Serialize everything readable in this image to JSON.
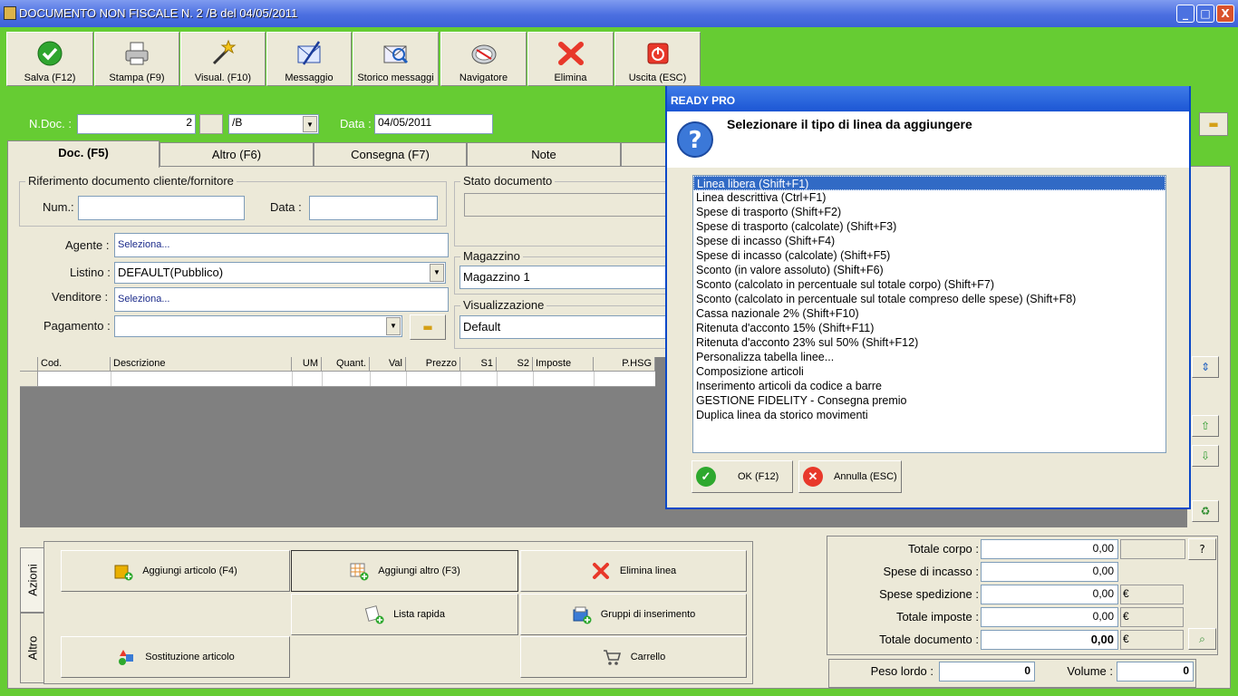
{
  "window": {
    "title": "DOCUMENTO NON FISCALE N.  2 /B del 04/05/2011",
    "min": "_",
    "max": "□",
    "close": "X"
  },
  "toolbar": [
    {
      "label": "Salva (F12)",
      "icon": "save-check-icon"
    },
    {
      "label": "Stampa (F9)",
      "icon": "printer-icon"
    },
    {
      "label": "Visual. (F10)",
      "icon": "magic-wand-icon"
    },
    {
      "label": "Messaggio",
      "icon": "message-icon"
    },
    {
      "label": "Storico messaggi",
      "icon": "message-history-icon"
    },
    {
      "label": "Navigatore",
      "icon": "navigator-icon"
    },
    {
      "label": "Elimina",
      "icon": "delete-x-icon"
    },
    {
      "label": "Uscita (ESC)",
      "icon": "exit-power-icon"
    }
  ],
  "header": {
    "ndoc_label": "N.Doc. :",
    "ndoc_value": "2",
    "serie_value": "/B",
    "data_label": "Data :",
    "data_value": "04/05/2011"
  },
  "tabs": [
    "Doc. (F5)",
    "Altro (F6)",
    "Consegna (F7)",
    "Note"
  ],
  "rif": {
    "title": "Riferimento documento cliente/fornitore",
    "num_label": "Num.:",
    "num_value": "",
    "data_label": "Data :",
    "data_value": ""
  },
  "agente": {
    "label": "Agente :",
    "value": "Seleziona..."
  },
  "listino": {
    "label": "Listino :",
    "value": "DEFAULT(Pubblico)"
  },
  "venditore": {
    "label": "Venditore :",
    "value": "Seleziona..."
  },
  "pagamento": {
    "label": "Pagamento :",
    "value": ""
  },
  "stato": {
    "title": "Stato documento",
    "value": ""
  },
  "magazzino": {
    "title": "Magazzino",
    "value": "Magazzino 1"
  },
  "visualizzazione": {
    "title": "Visualizzazione",
    "value": "Default"
  },
  "grid_columns": [
    "Cod.",
    "Descrizione",
    "UM",
    "Quant.",
    "Val",
    "Prezzo",
    "S1",
    "S2",
    "Imposte",
    "P.HSG"
  ],
  "side_tabs": [
    "Azioni",
    "Altro"
  ],
  "actions": {
    "aggiungi_articolo": "Aggiungi articolo (F4)",
    "aggiungi_altro": "Aggiungi altro (F3)",
    "elimina_linea": "Elimina linea",
    "lista_rapida": "Lista rapida",
    "gruppi": "Gruppi di inserimento",
    "sostituzione": "Sostituzione articolo",
    "carrello": "Carrello"
  },
  "totals": {
    "corpo_label": "Totale corpo :",
    "corpo_value": "0,00",
    "incasso_label": "Spese di incasso :",
    "incasso_value": "0,00",
    "spedizione_label": "Spese spedizione :",
    "spedizione_value": "0,00",
    "spedizione_cur": "€",
    "imposte_label": "Totale imposte :",
    "imposte_value": "0,00",
    "imposte_cur": "€",
    "documento_label": "Totale documento :",
    "documento_value": "0,00",
    "documento_cur": "€",
    "peso_label": "Peso lordo :",
    "peso_value": "0",
    "volume_label": "Volume :",
    "volume_value": "0",
    "help": "?"
  },
  "dialog": {
    "title": "READY PRO",
    "question": "Selezionare il tipo di linea da aggiungere",
    "items": [
      "Linea libera (Shift+F1)",
      "Linea descrittiva (Ctrl+F1)",
      "Spese di trasporto (Shift+F2)",
      "Spese di trasporto (calcolate) (Shift+F3)",
      "Spese di incasso (Shift+F4)",
      "Spese di incasso (calcolate) (Shift+F5)",
      "Sconto (in valore assoluto) (Shift+F6)",
      "Sconto (calcolato in percentuale sul totale corpo) (Shift+F7)",
      "Sconto (calcolato in percentuale sul totale compreso delle spese) (Shift+F8)",
      "Cassa nazionale 2% (Shift+F10)",
      "Ritenuta d'acconto 15% (Shift+F11)",
      "Ritenuta d'acconto 23% sul 50% (Shift+F12)",
      "Personalizza tabella linee...",
      "Composizione articoli",
      "Inserimento articoli da codice a barre",
      "GESTIONE FIDELITY - Consegna premio",
      "Duplica linea da storico movimenti"
    ],
    "selected_index": 0,
    "ok": "OK (F12)",
    "cancel": "Annulla (ESC)"
  }
}
